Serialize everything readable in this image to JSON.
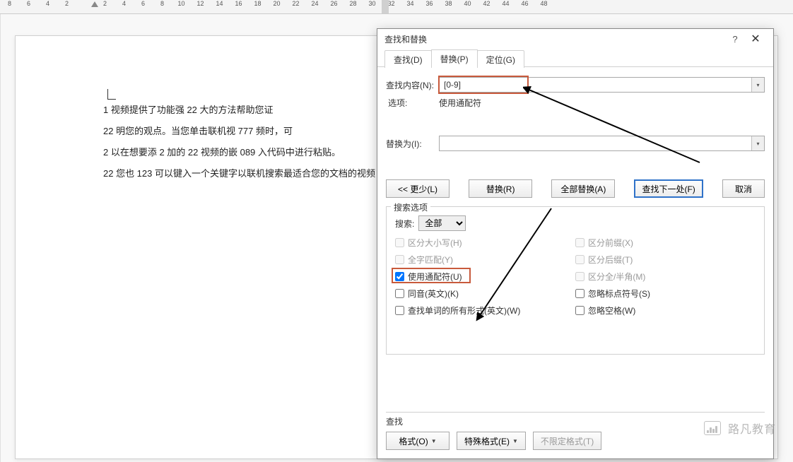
{
  "ruler": {
    "ticks": [
      "8",
      "6",
      "4",
      "2",
      "",
      "2",
      "4",
      "6",
      "8",
      "10",
      "12",
      "14",
      "16",
      "18",
      "20",
      "22",
      "24",
      "26",
      "28",
      "30",
      "32",
      "34",
      "36",
      "38",
      "40",
      "42",
      "44",
      "46",
      "48"
    ]
  },
  "doc": {
    "lines": [
      "1 视频提供了功能强 22 大的方法帮助您证",
      "22 明您的观点。当您单击联机视 777 频时，可",
      "2 以在想要添 2 加的 22 视频的嵌 089 入代码中进行粘贴。",
      "22 您也 123 可以键入一个关键字以联机搜索最适合您的文档的视频"
    ]
  },
  "dialog": {
    "title": "查找和替换",
    "tabs": {
      "find": "查找(D)",
      "replace": "替换(P)",
      "goto": "定位(G)"
    },
    "find_label": "查找内容(N):",
    "find_value": "[0-9]",
    "options_label": "选项:",
    "options_value": "使用通配符",
    "replace_label": "替换为(I):",
    "replace_value": "",
    "buttons": {
      "less": "<< 更少(L)",
      "replace": "替换(R)",
      "replace_all": "全部替换(A)",
      "find_next": "查找下一处(F)",
      "cancel": "取消"
    },
    "search_options_legend": "搜索选项",
    "search_label": "搜索:",
    "search_scope": "全部",
    "checks_left": [
      {
        "label": "区分大小写(H)",
        "checked": false,
        "disabled": true
      },
      {
        "label": "全字匹配(Y)",
        "checked": false,
        "disabled": true
      },
      {
        "label": "使用通配符(U)",
        "checked": true,
        "disabled": false,
        "highlight": true
      },
      {
        "label": "同音(英文)(K)",
        "checked": false,
        "disabled": false
      },
      {
        "label": "查找单词的所有形式(英文)(W)",
        "checked": false,
        "disabled": false
      }
    ],
    "checks_right": [
      {
        "label": "区分前缀(X)",
        "checked": false,
        "disabled": true
      },
      {
        "label": "区分后缀(T)",
        "checked": false,
        "disabled": true
      },
      {
        "label": "区分全/半角(M)",
        "checked": false,
        "disabled": true
      },
      {
        "label": "忽略标点符号(S)",
        "checked": false,
        "disabled": false
      },
      {
        "label": "忽略空格(W)",
        "checked": false,
        "disabled": false
      }
    ],
    "bottom_legend": "查找",
    "bottom_buttons": {
      "format": "格式(O)",
      "special": "特殊格式(E)",
      "noformat": "不限定格式(T)"
    }
  },
  "watermark": "路凡教育"
}
